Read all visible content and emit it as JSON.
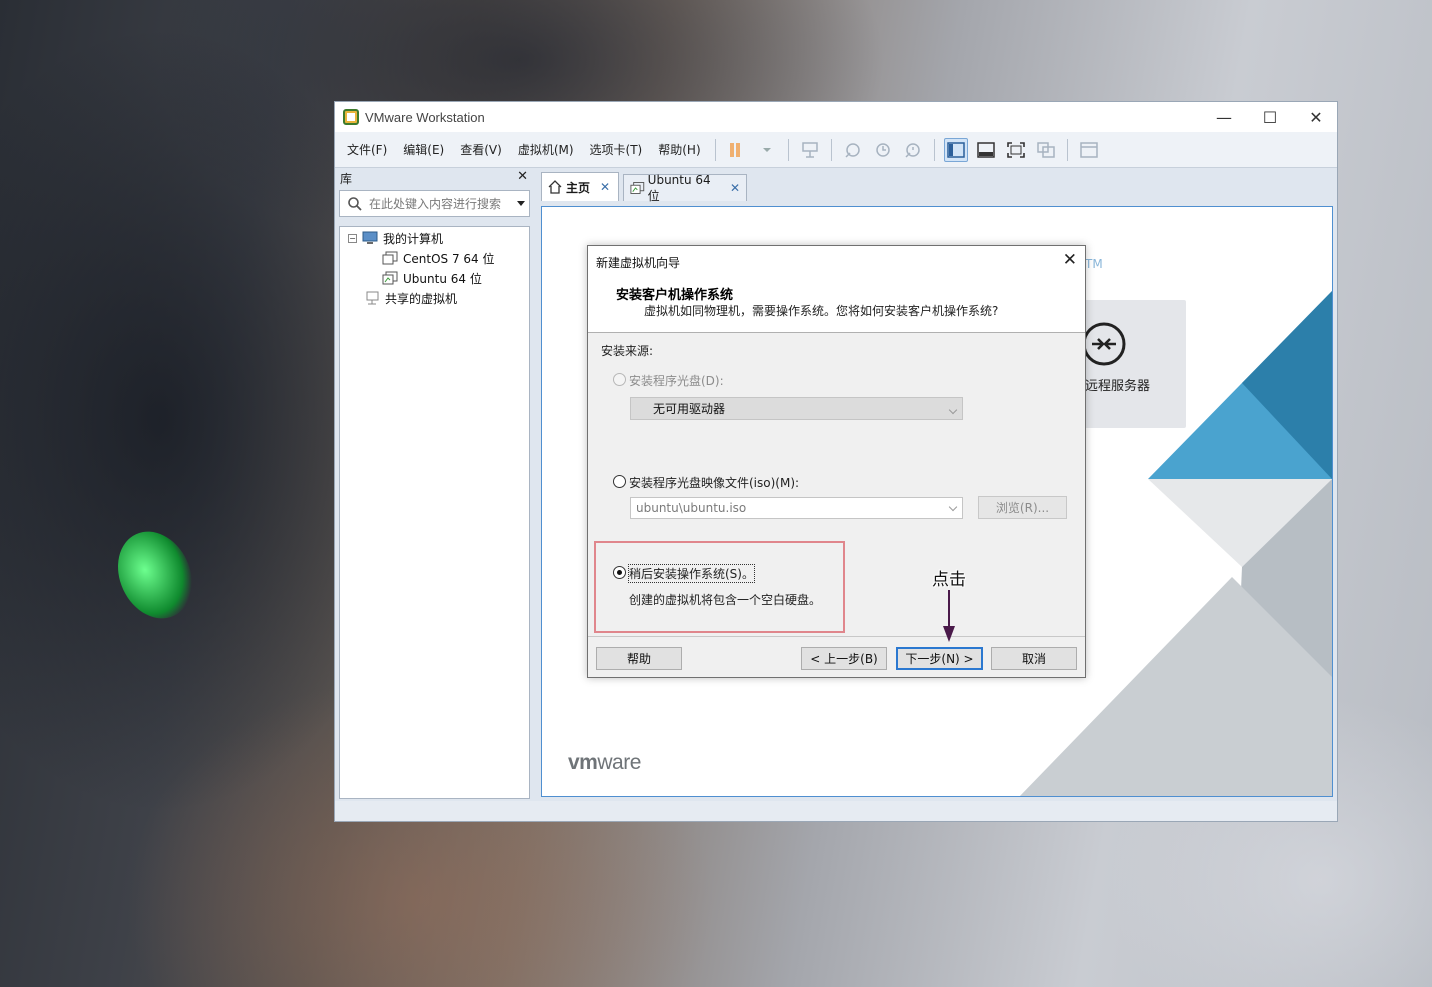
{
  "window": {
    "title": "VMware Workstation",
    "controls": {
      "minimize": "—",
      "maximize": "☐",
      "close": "✕"
    }
  },
  "menubar": {
    "items": [
      "文件(F)",
      "编辑(E)",
      "查看(V)",
      "虚拟机(M)",
      "选项卡(T)",
      "帮助(H)"
    ]
  },
  "toolbar": {
    "icons": [
      "pause-icon",
      "send-keys-icon",
      "snapshot-icon",
      "revert-snapshot-icon",
      "snapshot-manager-icon",
      "show-library-icon",
      "thumbnail-icon",
      "fullscreen-icon",
      "unity-icon",
      "console-view-icon"
    ]
  },
  "library": {
    "title": "库",
    "close": "✕",
    "search_placeholder": "在此处键入内容进行搜索",
    "tree": {
      "root": "我的计算机",
      "vms": [
        "CentOS 7 64 位",
        "Ubuntu 64 位"
      ],
      "shared": "共享的虚拟机"
    }
  },
  "tabs": [
    {
      "label": "主页",
      "close": "✕",
      "active": true
    },
    {
      "label": "Ubuntu 64 位",
      "close": "✕",
      "active": false
    }
  ],
  "home": {
    "tm": "TM",
    "remote_server": "远程服务器",
    "logo_vm": "vm",
    "logo_ware": "ware"
  },
  "dialog": {
    "title": "新建虚拟机向导",
    "close": "✕",
    "heading": "安装客户机操作系统",
    "subheading": "虚拟机如同物理机，需要操作系统。您将如何安装客户机操作系统?",
    "source_label": "安装来源:",
    "option_disc": {
      "label": "安装程序光盘(D):",
      "selected": false,
      "enabled": false
    },
    "disc_combo_value": "无可用驱动器",
    "option_iso": {
      "label": "安装程序光盘映像文件(iso)(M):",
      "selected": false,
      "enabled": true
    },
    "iso_path": "ubuntu\\ubuntu.iso",
    "browse_button": "浏览(R)...",
    "option_later": {
      "label": "稍后安装操作系统(S)。",
      "selected": true,
      "enabled": true
    },
    "later_description": "创建的虚拟机将包含一个空白硬盘。",
    "buttons": {
      "help": "帮助",
      "back": "< 上一步(B)",
      "next": "下一步(N) >",
      "cancel": "取消"
    }
  },
  "annotation": {
    "text": "点击"
  },
  "colors": {
    "accent": "#2b78d0",
    "highlight_box": "#e0868c",
    "tab_close": "#3a6ea8",
    "tm": "#8ab6d9",
    "arrow": "#4a1a4a"
  }
}
